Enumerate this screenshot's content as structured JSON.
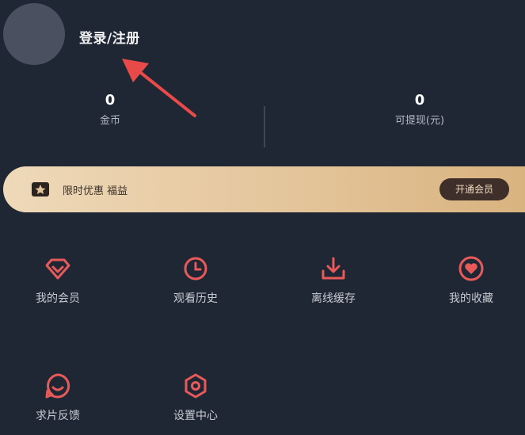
{
  "profile": {
    "login_label": "登录/注册"
  },
  "stats": [
    {
      "value": "0",
      "label": "金币"
    },
    {
      "value": "0",
      "label": "可提现(元)"
    }
  ],
  "vip_banner": {
    "icon": "vip-ticket-icon",
    "text": "限时优惠 福益",
    "button_label": "开通会员"
  },
  "menu": [
    {
      "label": "我的会员",
      "icon": "diamond-icon"
    },
    {
      "label": "观看历史",
      "icon": "clock-icon"
    },
    {
      "label": "离线缓存",
      "icon": "download-icon"
    },
    {
      "label": "我的收藏",
      "icon": "heart-icon"
    },
    {
      "label": "求片反馈",
      "icon": "feedback-icon"
    },
    {
      "label": "设置中心",
      "icon": "settings-icon"
    }
  ],
  "colors": {
    "background": "#1f2734",
    "accent": "#e85a5a",
    "annotation_arrow": "#e84a4a",
    "banner_gold": "#e4c59b"
  }
}
